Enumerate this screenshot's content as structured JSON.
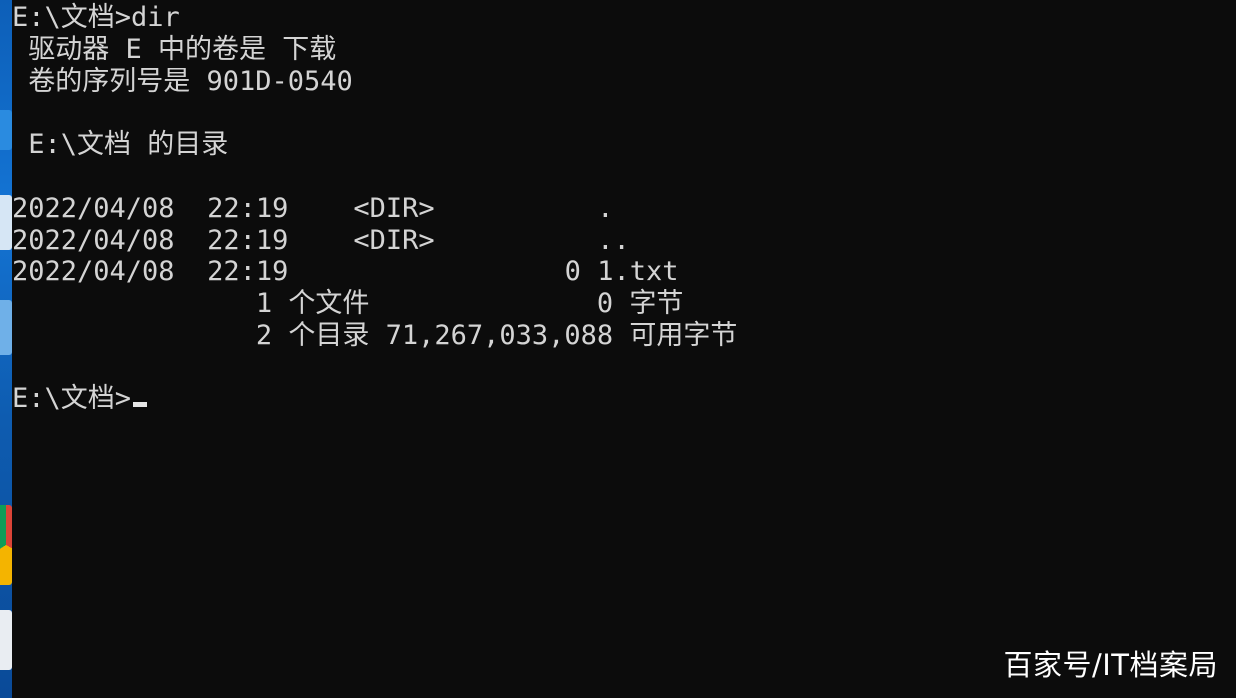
{
  "console": {
    "lines": [
      "E:\\文档>dir",
      " 驱动器 E 中的卷是 下载",
      " 卷的序列号是 901D-0540",
      "",
      " E:\\文档 的目录",
      "",
      "2022/04/08  22:19    <DIR>          .",
      "2022/04/08  22:19    <DIR>          ..",
      "2022/04/08  22:19                 0 1.txt",
      "               1 个文件              0 字节",
      "               2 个目录 71,267,033,088 可用字节",
      "",
      "E:\\文档>"
    ]
  },
  "watermark": "百家号/IT档案局"
}
